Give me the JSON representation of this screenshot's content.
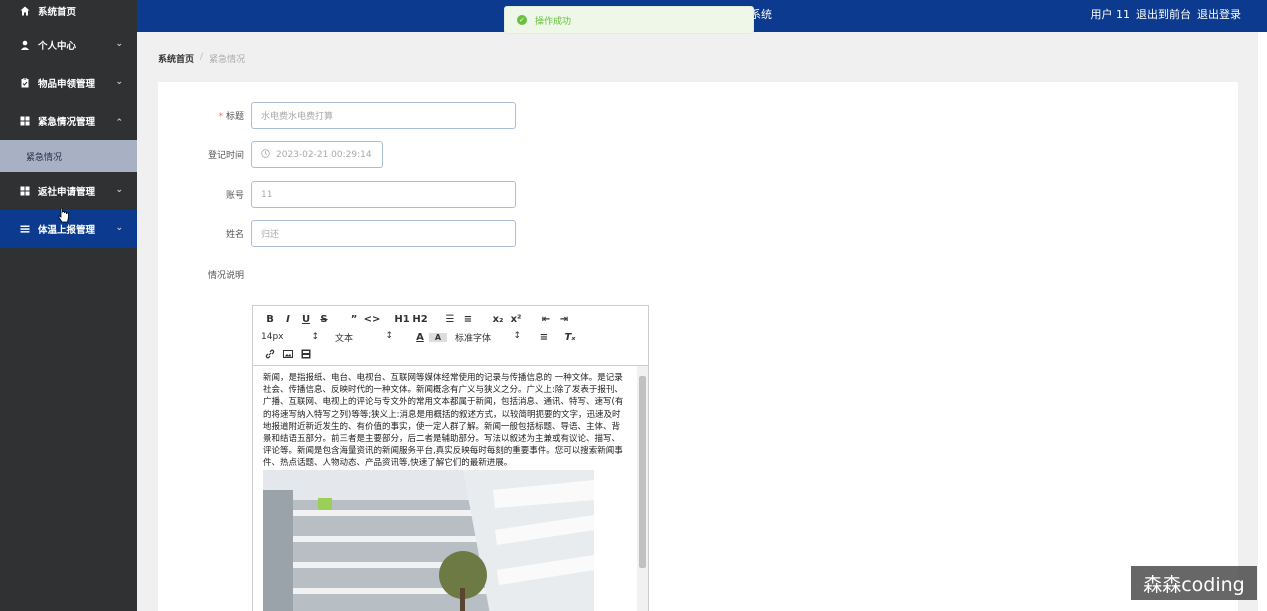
{
  "sidebar": {
    "items": [
      {
        "label": "系统首页",
        "icon": "home-icon"
      },
      {
        "label": "个人中心",
        "icon": "user-icon"
      },
      {
        "label": "物品申领管理",
        "icon": "clipboard-icon"
      },
      {
        "label": "紧急情况管理",
        "icon": "grid-icon"
      },
      {
        "label": "紧急情况",
        "icon": ""
      },
      {
        "label": "返社申请管理",
        "icon": "grid-icon"
      },
      {
        "label": "体温上报管理",
        "icon": "list-icon"
      }
    ]
  },
  "header": {
    "title_fragment": "系统",
    "user": "用户 11",
    "to_frontend": "退出到前台",
    "logout": "退出登录"
  },
  "toast": {
    "message": "操作成功"
  },
  "breadcrumb": {
    "home": "系统首页",
    "current": "紧急情况"
  },
  "form": {
    "title_label": "标题",
    "title_value": "水电费水电费打算",
    "time_label": "登记时间",
    "time_value": "2023-02-21 00:29:14",
    "account_label": "账号",
    "account_value": "11",
    "name_label": "姓名",
    "name_value": "归还",
    "desc_label": "情况说明"
  },
  "editor": {
    "toolbar_row1": [
      "B",
      "I",
      "U",
      "S",
      "”",
      "<>",
      "H1",
      "H2",
      "☰",
      "≡",
      "x₂",
      "x²",
      "⇤",
      "⇥"
    ],
    "font_size": "14px",
    "text_style": "文本",
    "font_family": "标准字体",
    "content": "新闻，是指报纸、电台、电视台、互联网等媒体经常使用的记录与传播信息的 一种文体。是记录社会、传播信息、反映时代的一种文体。新闻概念有广义与狭义之分。广义上:除了发表于报刊、广播、互联网、电视上的评论与专文外的常用文本都属于新闻，包括消息、通讯、特写、速写(有的将速写纳入特写之列)等等;狭义上:消息是用概括的叙述方式，以较简明扼要的文字，迅速及时地报道附近新近发生的、有价值的事实，使一定人群了解。新闻一般包括标题、导语、主体、背景和结语五部分。前三者是主要部分，后二者是辅助部分。写法以叙述为主兼或有议论、描写、评论等。新闻是包含海量资讯的新闻服务平台,真实反映每时每刻的重要事件。您可以搜索新闻事件、热点话题、人物动态、产品资讯等,快速了解它们的最新进展。"
  },
  "watermark": "森森coding",
  "colors": {
    "sidebar": "#2f3133",
    "header": "#0c3a8f",
    "submenu": "#a8b0c3",
    "success": "#67c23a"
  }
}
